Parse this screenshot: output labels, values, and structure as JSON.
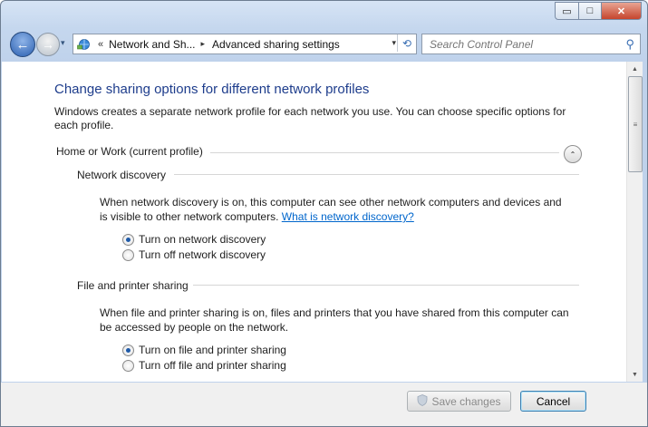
{
  "window": {
    "minimize": "▭",
    "maximize": "□",
    "close": "✕"
  },
  "nav": {
    "back": "←",
    "forward": "→",
    "recent": "▾",
    "breadcrumb_prefix": "«",
    "crumbs": [
      "Network and Sh...",
      "Advanced sharing settings"
    ],
    "crumb_separator": "▸",
    "dropdown": "▾",
    "refresh": "⟲",
    "search_placeholder": "Search Control Panel",
    "search_icon": "⚲"
  },
  "page": {
    "title": "Change sharing options for different network profiles",
    "intro": "Windows creates a separate network profile for each network you use. You can choose specific options for each profile.",
    "profile_label": "Home or Work (current profile)",
    "collapse_icon": "⌃"
  },
  "network_discovery": {
    "heading": "Network discovery",
    "description": "When network discovery is on, this computer can see other network computers and devices and is visible to other network computers.",
    "link": "What is network discovery?",
    "options": [
      "Turn on network discovery",
      "Turn off network discovery"
    ],
    "selected": 0
  },
  "file_sharing": {
    "heading": "File and printer sharing",
    "description": "When file and printer sharing is on, files and printers that you have shared from this computer can be accessed by people on the network.",
    "options": [
      "Turn on file and printer sharing",
      "Turn off file and printer sharing"
    ],
    "selected": 0
  },
  "footer": {
    "save": "Save changes",
    "cancel": "Cancel"
  },
  "scrollbar": {
    "up": "▲",
    "down": "▼",
    "grip": "≡"
  }
}
